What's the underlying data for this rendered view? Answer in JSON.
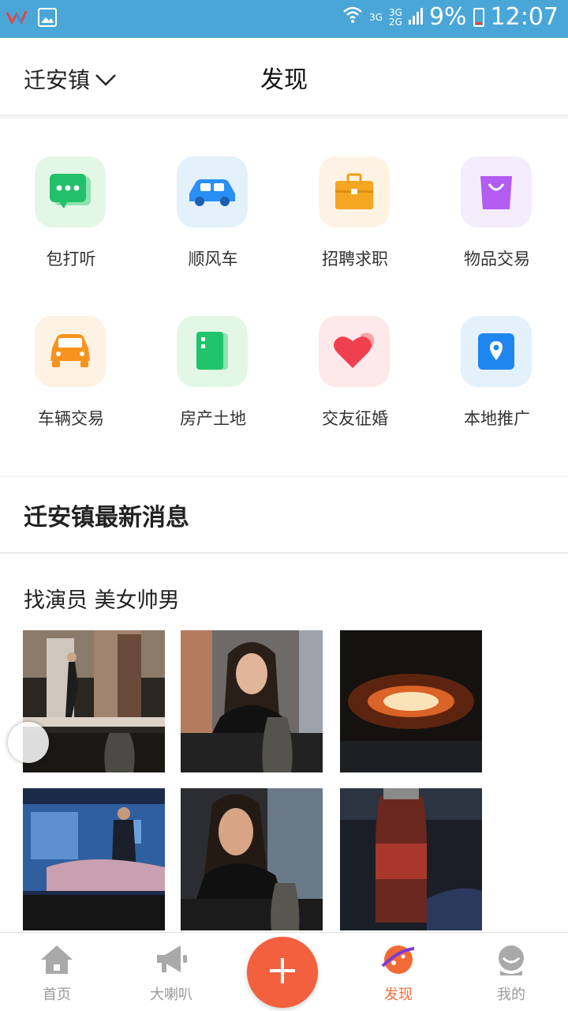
{
  "status_bar": {
    "network_top": "3G",
    "network_right_top": "3G",
    "network_right_bottom": "2G",
    "battery": "9%",
    "time": "12:07"
  },
  "header": {
    "location": "迁安镇",
    "title": "发现"
  },
  "categories": [
    {
      "label": "包打听",
      "icon": "chat-bubble-icon",
      "bg": "#e3f7e6",
      "color": "#2dc06a"
    },
    {
      "label": "顺风车",
      "icon": "car-icon",
      "bg": "#e3f1fb",
      "color": "#2a8ff2"
    },
    {
      "label": "招聘求职",
      "icon": "briefcase-icon",
      "bg": "#fdf3e4",
      "color": "#f5a623"
    },
    {
      "label": "物品交易",
      "icon": "shopping-bag-icon",
      "bg": "#f3ecfb",
      "color": "#a94ef0"
    },
    {
      "label": "车辆交易",
      "icon": "car-icon",
      "bg": "#fdf2e3",
      "color": "#f7931e"
    },
    {
      "label": "房产土地",
      "icon": "building-icon",
      "bg": "#e3f7e6",
      "color": "#1fc46b"
    },
    {
      "label": "交友征婚",
      "icon": "heart-icon",
      "bg": "#fde8ea",
      "color": "#f0404e"
    },
    {
      "label": "本地推广",
      "icon": "location-pin-icon",
      "bg": "#e3f1fb",
      "color": "#1f86f0"
    }
  ],
  "news": {
    "heading": "迁安镇最新消息"
  },
  "post": {
    "title": "找演员 美女帅男"
  },
  "tabs": [
    {
      "label": "首页",
      "icon": "home-icon"
    },
    {
      "label": "大喇叭",
      "icon": "megaphone-icon"
    },
    {
      "label": "发现",
      "icon": "planet-icon"
    },
    {
      "label": "我的",
      "icon": "profile-icon"
    }
  ],
  "colors": {
    "status_bar": "#4aa6d6",
    "accent": "#f16b37",
    "plus_button": "#f2603e"
  }
}
